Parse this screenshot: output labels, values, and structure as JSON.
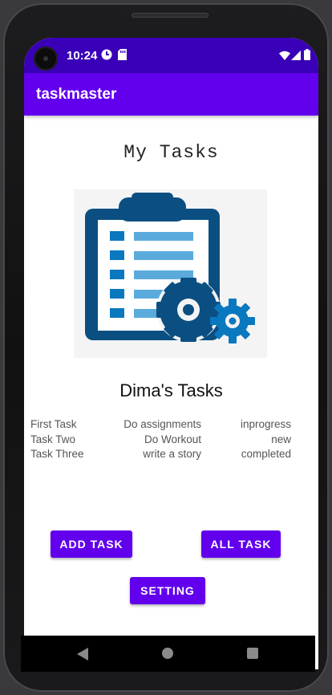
{
  "status_bar": {
    "time": "10:24",
    "icons": [
      "notification-app-icon",
      "sd-card-icon",
      "wifi-icon",
      "cellular-signal-icon",
      "battery-icon"
    ]
  },
  "app_bar": {
    "title": "taskmaster"
  },
  "main": {
    "heading": "My Tasks",
    "illustration": "clipboard-checklist-gears-icon",
    "subheading": "Dima's Tasks",
    "tasks": [
      {
        "title": "First Task",
        "body": "Do assignments",
        "state": "inprogress"
      },
      {
        "title": "Task Two",
        "body": "Do Workout",
        "state": "new"
      },
      {
        "title": "Task Three",
        "body": "write a story",
        "state": "completed"
      }
    ],
    "buttons": {
      "add_task": "ADD TASK",
      "all_task": "ALL TASK",
      "setting": "SETTING"
    }
  },
  "nav_bar": {
    "icons": [
      "back-triangle-icon",
      "home-circle-icon",
      "recents-square-icon"
    ]
  },
  "colors": {
    "primary": "#6200ee",
    "status_bar": "#3a00b8",
    "illustration_dark": "#0b4f82",
    "illustration_light": "#5aabdc"
  }
}
